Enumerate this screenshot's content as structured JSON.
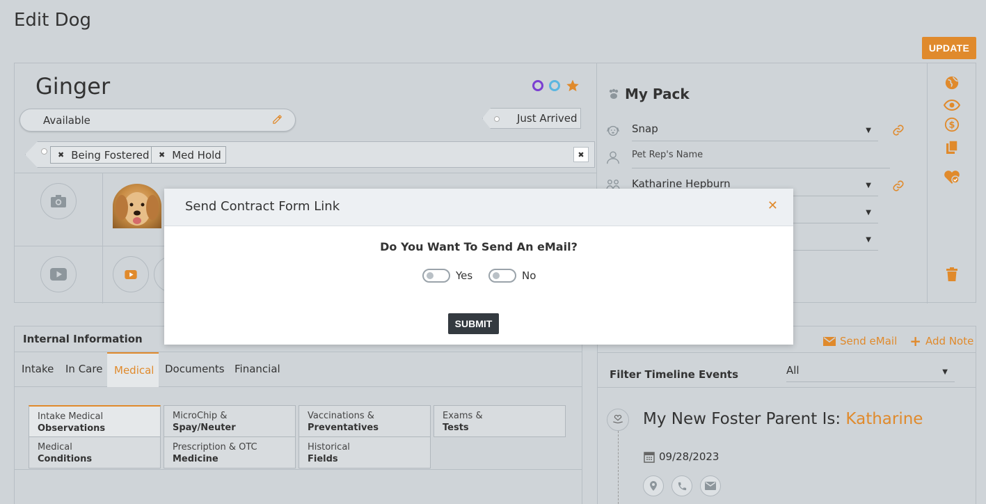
{
  "page": {
    "title": "Edit Dog",
    "update_label": "UPDATE"
  },
  "dog": {
    "name": "Ginger",
    "status": "Available",
    "tag": "Just Arrived",
    "holds": [
      "Being Fostered",
      "Med Hold"
    ]
  },
  "pack": {
    "title": "My Pack",
    "rows": [
      {
        "value": "Snap",
        "icon": "dog-face-icon"
      },
      {
        "value": "Pet Rep's Name",
        "icon": "person-icon"
      },
      {
        "value": "Katharine Hepburn",
        "icon": "family-icon"
      }
    ]
  },
  "internal": {
    "title": "Internal Information",
    "tabs": [
      "Intake",
      "In Care",
      "Medical",
      "Documents",
      "Financial"
    ],
    "active_tab": "Medical",
    "subtabs": [
      [
        "Intake Medical",
        "Observations"
      ],
      [
        "MicroChip &",
        "Spay/Neuter"
      ],
      [
        "Vaccinations &",
        "Preventatives"
      ],
      [
        "Exams &",
        "Tests"
      ],
      [
        "Medical",
        "Conditions"
      ],
      [
        "Prescription & OTC",
        "Medicine"
      ],
      [
        "Historical",
        "Fields"
      ]
    ]
  },
  "timeline": {
    "send_email": "Send eMail",
    "add_note": "Add Note",
    "filter_label": "Filter Timeline Events",
    "filter_value": "All",
    "event_title_prefix": "My New Foster Parent Is: ",
    "event_title_name": "Katharine",
    "event_date": "09/28/2023"
  },
  "modal": {
    "title": "Send Contract Form Link",
    "question": "Do You Want To Send An eMail?",
    "yes_label": "Yes",
    "no_label": "No",
    "submit_label": "SUBMIT"
  },
  "colors": {
    "accent": "#e08a2c",
    "ring_purple": "#7b3fd1",
    "ring_blue": "#5bb6e0",
    "background": "#cfd4d8"
  }
}
